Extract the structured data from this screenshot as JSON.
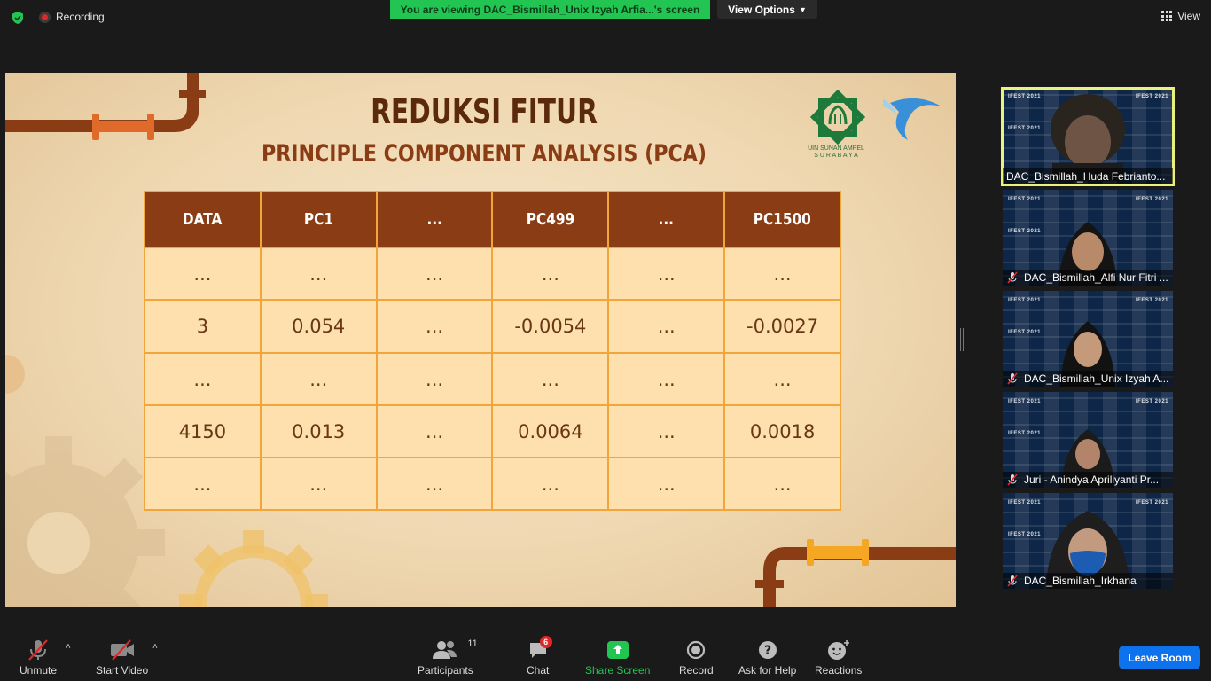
{
  "topbar": {
    "recording_label": "Recording",
    "viewing_banner": "You are viewing DAC_Bismillah_Unix Izyah Arfia...'s screen",
    "view_options_label": "View Options",
    "view_label": "View"
  },
  "slide": {
    "title": "REDUKSI FITUR",
    "subtitle": "PRINCIPLE COMPONENT ANALYSIS (PCA)",
    "logo_caption_line1": "UIN SUNAN AMPEL",
    "logo_caption_line2": "S U R A B A Y A",
    "table": {
      "headers": [
        "DATA",
        "PC1",
        "...",
        "PC499",
        "...",
        "PC1500"
      ],
      "rows": [
        [
          "...",
          "...",
          "...",
          "...",
          "...",
          "..."
        ],
        [
          "3",
          "0.054",
          "...",
          "-0.0054",
          "...",
          "-0.0027"
        ],
        [
          "...",
          "...",
          "...",
          "...",
          "...",
          "..."
        ],
        [
          "4150",
          "0.013",
          "...",
          "0.0064",
          "...",
          "0.0018"
        ],
        [
          "...",
          "...",
          "...",
          "...",
          "...",
          "..."
        ]
      ]
    }
  },
  "participants": [
    {
      "name": "DAC_Bismillah_Huda Febrianto...",
      "muted": false,
      "active": true
    },
    {
      "name": "DAC_Bismillah_Alfi Nur Fitri ...",
      "muted": true,
      "active": false
    },
    {
      "name": "DAC_Bismillah_Unix Izyah A...",
      "muted": true,
      "active": false
    },
    {
      "name": "Juri - Anindya Apriliyanti Pr...",
      "muted": true,
      "active": false
    },
    {
      "name": "DAC_Bismillah_Irkhana",
      "muted": true,
      "active": false
    }
  ],
  "tile_watermark": "IFEST 2021",
  "toolbar": {
    "unmute": "Unmute",
    "start_video": "Start Video",
    "participants": "Participants",
    "participants_count": "11",
    "chat": "Chat",
    "chat_badge": "6",
    "share_screen": "Share Screen",
    "record": "Record",
    "ask_for_help": "Ask for Help",
    "reactions": "Reactions",
    "leave_room": "Leave Room"
  },
  "colors": {
    "share_green": "#23c552",
    "leave_blue": "#0e72ed",
    "table_header": "#8a3d14",
    "table_cell": "#fde0ad",
    "table_border": "#f0a638",
    "active_speaker": "#e9f27a"
  }
}
